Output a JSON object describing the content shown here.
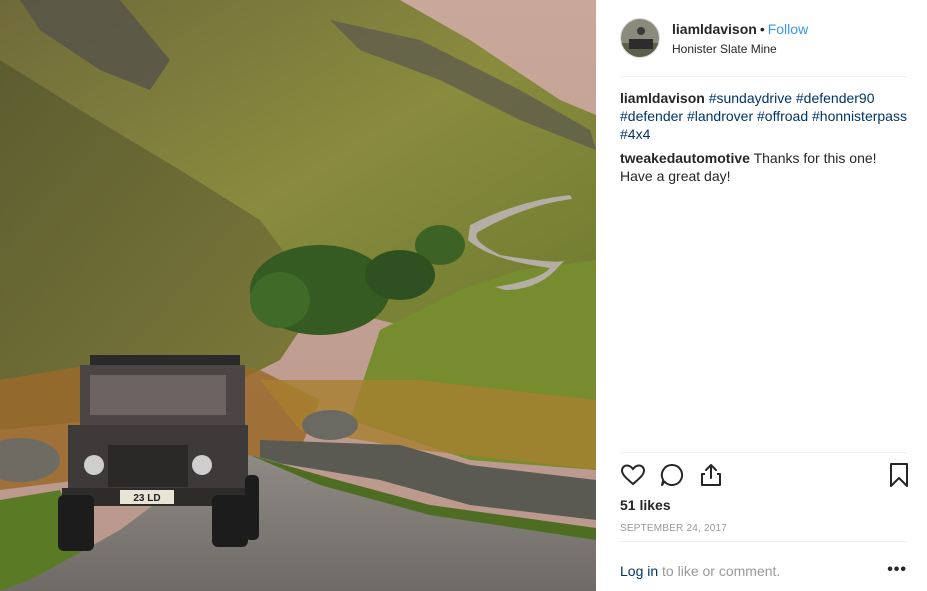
{
  "post": {
    "username": "liamldavison",
    "separator": "•",
    "follow_label": "Follow",
    "location": "Honister Slate Mine",
    "photo_plate": "23 LD"
  },
  "comments": [
    {
      "user": "liamldavison",
      "tags": [
        "#sundaydrive",
        "#defender90",
        "#defender",
        "#landrover",
        "#offroad",
        "#honnisterpass",
        "#4x4"
      ]
    },
    {
      "user": "tweakedautomotive",
      "text": "Thanks for this one! Have a great day!"
    }
  ],
  "icons": [
    "heart-icon",
    "comment-icon",
    "share-icon",
    "bookmark-icon",
    "more-options-icon"
  ],
  "likes": "51 likes",
  "date": "SEPTEMBER 24, 2017",
  "footer": {
    "login_label": "Log in",
    "rest": " to like or comment.",
    "more_label": "•••"
  }
}
